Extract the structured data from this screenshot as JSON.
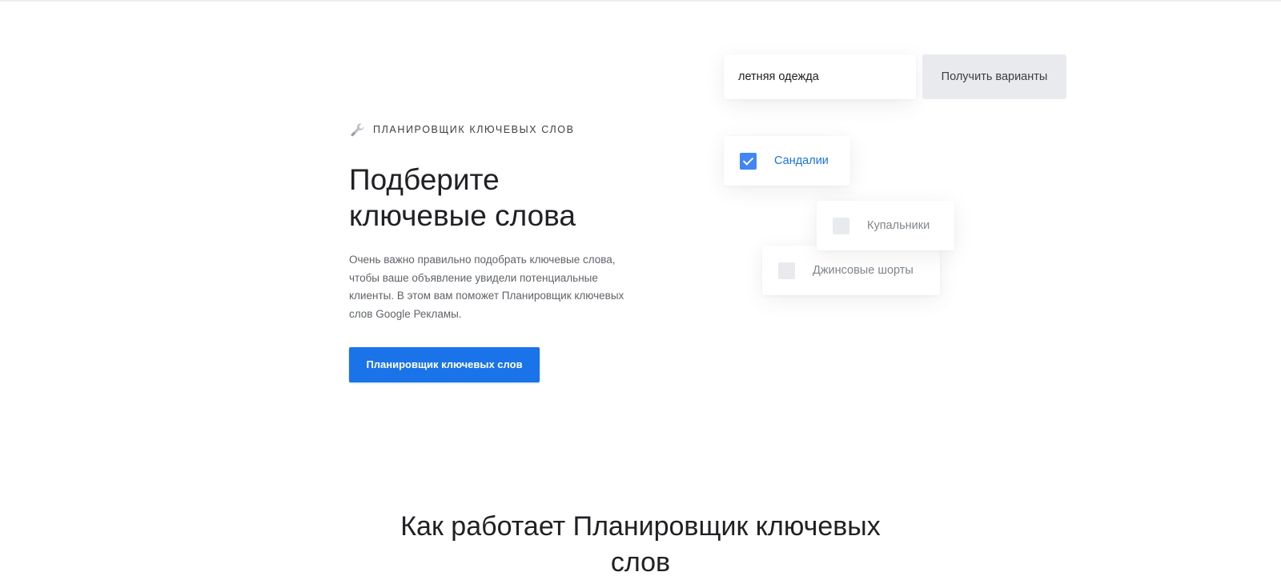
{
  "hero": {
    "eyebrow_icon": "wrench-icon",
    "eyebrow": "ПЛАНИРОВЩИК КЛЮЧЕВЫХ СЛОВ",
    "title_line1": "Подберите",
    "title_line2": "ключевые слова",
    "body": "Очень важно правильно подобрать ключевые слова, чтобы ваше объявление увидели потенциальные клиенты. В этом вам поможет Планировщик ключевых слов Google Рекламы.",
    "cta_label": "Планировщик ключевых слов"
  },
  "demo": {
    "search_value": "летняя одежда",
    "get_button": "Получить варианты",
    "options": [
      {
        "label": "Сандалии",
        "checked": true
      },
      {
        "label": "Купальники",
        "checked": false
      },
      {
        "label": "Джинсовые шорты",
        "checked": false
      }
    ]
  },
  "section": {
    "title_line1": "Как работает Планировщик ключевых",
    "title_line2": "слов"
  },
  "colors": {
    "accent": "#1a73e8",
    "checkbox_on": "#4285f4",
    "checkbox_off": "#e8eaed"
  }
}
